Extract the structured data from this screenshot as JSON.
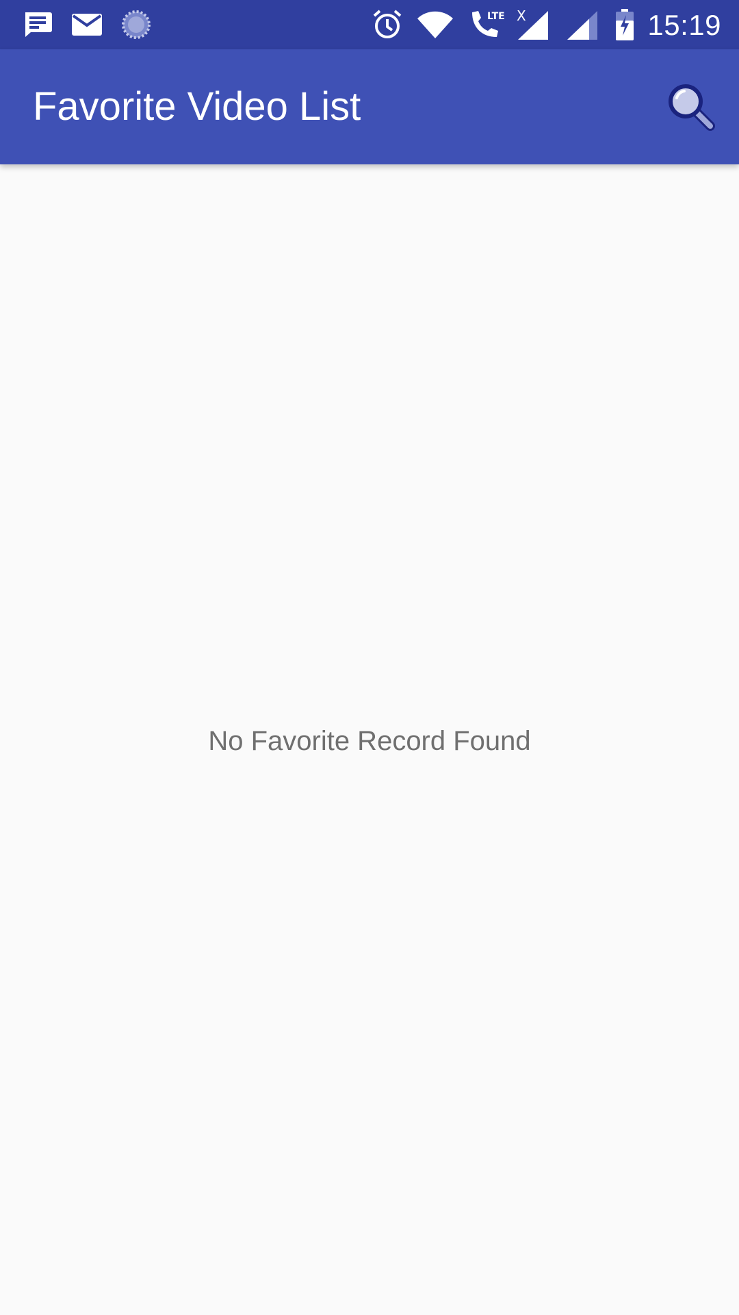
{
  "status_bar": {
    "time": "15:19",
    "left_icons": [
      "notes-icon",
      "mail-icon",
      "sync-progress-icon"
    ],
    "right_icons": [
      "alarm-icon",
      "wifi-icon",
      "lte-call-icon",
      "signal-icon",
      "signal-icon",
      "battery-charging-icon"
    ],
    "lte_label": "LTE",
    "no_sim_mark": "X",
    "background_color": "#303f9f"
  },
  "app_bar": {
    "title": "Favorite Video List",
    "search_icon": "search-icon",
    "background_color": "#3f51b5"
  },
  "content": {
    "empty_message": "No Favorite Record Found"
  }
}
